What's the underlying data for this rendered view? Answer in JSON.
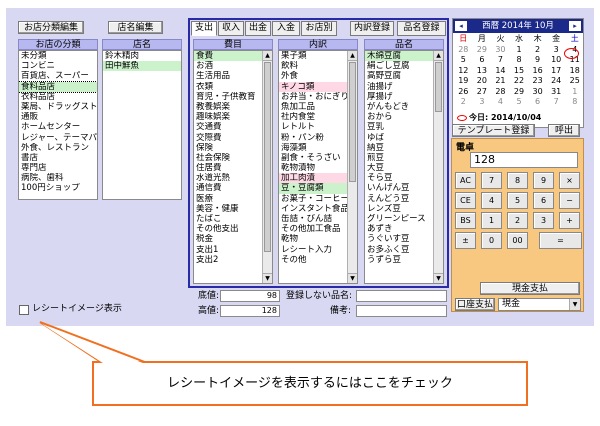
{
  "top_buttons": {
    "store_category_edit": "お店分類編集",
    "store_name_edit": "店名編集"
  },
  "category_list": {
    "header": "お店の分類",
    "items": [
      "未分類",
      "コンビニ",
      "百貨店、スーパー",
      "食料品店",
      "衣料品店",
      "薬局、ドラッグストア",
      "通販",
      "ホームセンター",
      "レジャー、テーマパーク",
      "外食、レストラン",
      "書店",
      "専門店",
      "病院、歯科",
      "100円ショップ"
    ],
    "selected_index": 3
  },
  "store_list": {
    "header": "店名",
    "items": [
      "鈴木精肉",
      "田中鮮魚"
    ],
    "selected_index": 1
  },
  "tabs": [
    "支出",
    "収入",
    "出金",
    "入金",
    "お店別"
  ],
  "panel_buttons": {
    "detail_register": "内訳登録",
    "item_register": "品名登録"
  },
  "expense_list": {
    "header": "費目",
    "items": [
      "食費",
      "お酒",
      "生活用品",
      "衣類",
      "育児・子供教育",
      "教養娯楽",
      "趣味娯楽",
      "交通費",
      "交際費",
      "保険",
      "社会保険",
      "住居費",
      "水道光熱",
      "通信費",
      "医療",
      "美容・健康",
      "たばこ",
      "その他支出",
      "税金",
      "支出1",
      "支出2"
    ],
    "selected_index": 0
  },
  "detail_list": {
    "header": "内訳",
    "items": [
      "果子類",
      "飲料",
      "外食",
      "キノコ類",
      "お弁当・おにぎり",
      "魚加工品",
      "社内食堂",
      "レトルト",
      "粉・パン粉",
      "海藻類",
      "副食・そうざい",
      "乾物漬物",
      "加工肉漬",
      "豆・豆腐類",
      "お菓子・コーヒー",
      "インスタント食品",
      "缶詰・びん詰",
      "その他加工食品",
      "乾物",
      "レシート入力",
      "その他"
    ],
    "selected_index": 13,
    "highlight_indices": [
      3,
      12
    ]
  },
  "item_list": {
    "header": "品名",
    "items": [
      "木綿豆腐",
      "絹ごし豆腐",
      "高野豆腐",
      "油揚げ",
      "厚揚げ",
      "がんもどき",
      "おから",
      "豆乳",
      "ゆば",
      "納豆",
      "煎豆",
      "大豆",
      "そら豆",
      "いんげん豆",
      "えんどう豆",
      "レンズ豆",
      "グリーンピース",
      "あずき",
      "うぐいす豆",
      "お多ふく豆",
      "うずら豆"
    ],
    "selected_index": 0
  },
  "calendar": {
    "title": "西暦 2014年 10月",
    "prev": "◂",
    "next": "▸",
    "weekdays": [
      "日",
      "月",
      "火",
      "水",
      "木",
      "金",
      "土"
    ],
    "weeks": [
      [
        "28",
        "29",
        "30",
        "1",
        "2",
        "3",
        "4"
      ],
      [
        "5",
        "6",
        "7",
        "8",
        "9",
        "10",
        "11"
      ],
      [
        "12",
        "13",
        "14",
        "15",
        "16",
        "17",
        "18"
      ],
      [
        "19",
        "20",
        "21",
        "22",
        "23",
        "24",
        "25"
      ],
      [
        "26",
        "27",
        "28",
        "29",
        "30",
        "31",
        "1"
      ],
      [
        "2",
        "3",
        "4",
        "5",
        "6",
        "7",
        "8"
      ]
    ],
    "today_label": "今日: 2014/10/04"
  },
  "template_button": "テンプレート登録",
  "recall_button": "呼出",
  "calculator": {
    "title": "電卓",
    "display": "128",
    "keys": [
      [
        "AC",
        "7",
        "8",
        "9",
        "×"
      ],
      [
        "CE",
        "4",
        "5",
        "6",
        "−"
      ],
      [
        "BS",
        "1",
        "2",
        "3",
        "+"
      ],
      [
        "±",
        "0",
        "00",
        "",
        ""
      ]
    ],
    "equals": "="
  },
  "cash_button": "現金支払",
  "payment": {
    "label": "口座支払",
    "value": "現金"
  },
  "bottom_fields": {
    "base_label": "底値:",
    "base_value": "98",
    "high_label": "高値:",
    "high_value": "128",
    "unregistered_label": "登録しない品名:",
    "unregistered_value": "",
    "note_label": "備考:",
    "note_value": ""
  },
  "receipt_checkbox": "レシートイメージ表示",
  "callout_text": "レシートイメージを表示するにはここをチェック",
  "colors": {
    "window": "#d8d8f2",
    "panel_border": "#2a2aa8",
    "calc_bg": "#f8c880",
    "callout_border": "#f07020",
    "selected": "#ccf2cc"
  }
}
